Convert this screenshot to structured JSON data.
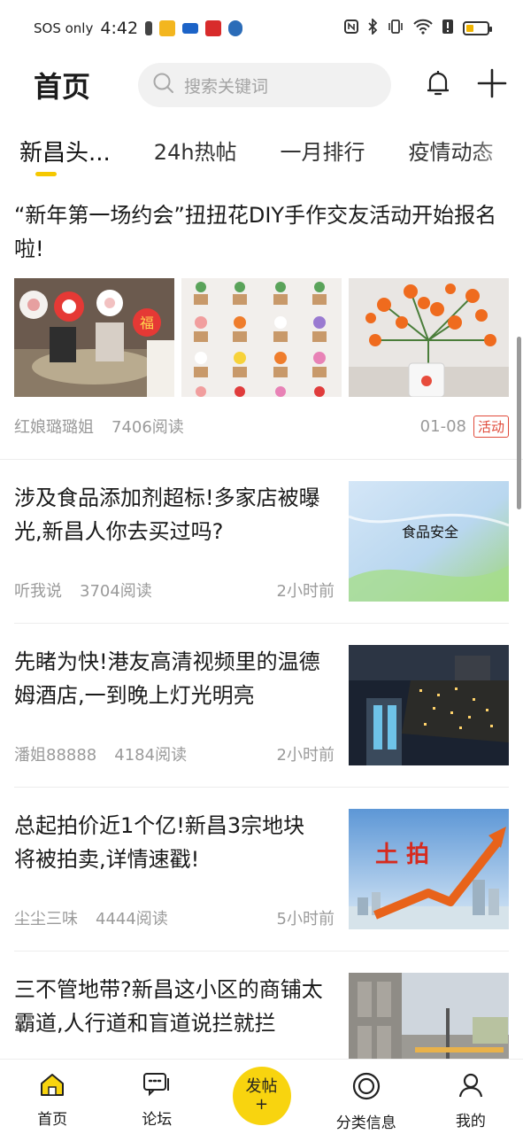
{
  "status_bar": {
    "carrier": "SOS only",
    "time": "4:42",
    "battery_level": 0.3,
    "battery_color": "#f0b400"
  },
  "header": {
    "title": "首页",
    "search_placeholder": "搜索关键词",
    "icons": [
      "bell-icon",
      "plus-icon"
    ]
  },
  "tabs": [
    {
      "label": "新昌头...",
      "active": true
    },
    {
      "label": "24h热帖",
      "active": false
    },
    {
      "label": "一月排行",
      "active": false
    },
    {
      "label": "疫情动态",
      "active": false
    }
  ],
  "feature_article": {
    "title": "“新年第一场约会”扭扭花DIY手作交友活动开始报名啦!",
    "author": "红娘璐璐姐",
    "views": "7406阅读",
    "date": "01-08",
    "tag": "活动"
  },
  "articles": [
    {
      "title": "涉及食品添加剂超标!多家店被曝光,新昌人你去买过吗?",
      "author": "听我说",
      "views": "3704阅读",
      "time": "2小时前",
      "thumb_caption": "食品安全"
    },
    {
      "title": "先睹为快!港友高清视频里的温德姆酒店,一到晚上灯光明亮",
      "author": "潘姐88888",
      "views": "4184阅读",
      "time": "2小时前",
      "thumb_caption": ""
    },
    {
      "title": "总起拍价近1个亿!新昌3宗地块将被拍卖,详情速戳!",
      "author": "尘尘三味",
      "views": "4444阅读",
      "time": "5小时前",
      "thumb_caption": "土 拍"
    },
    {
      "title": "三不管地带?新昌这小区的商铺太霸道,人行道和盲道说拦就拦",
      "author": "",
      "views": "",
      "time": "",
      "thumb_caption": ""
    }
  ],
  "bottom_nav": {
    "home": "首页",
    "forum": "论坛",
    "post": "发帖",
    "post_plus": "+",
    "classified": "分类信息",
    "me": "我的"
  },
  "colors": {
    "accent": "#f8d40f",
    "tag_red": "#e04a3a"
  }
}
